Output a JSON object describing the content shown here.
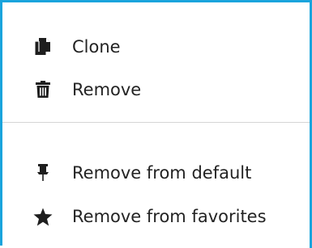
{
  "context_menu": {
    "accent_color": "#1aa4dc",
    "items": [
      {
        "label": "Clone",
        "icon": "copy-icon"
      },
      {
        "label": "Remove",
        "icon": "trash-icon"
      },
      {
        "label": "Remove from default",
        "icon": "pin-icon"
      },
      {
        "label": "Remove from favorites",
        "icon": "star-icon"
      }
    ]
  }
}
